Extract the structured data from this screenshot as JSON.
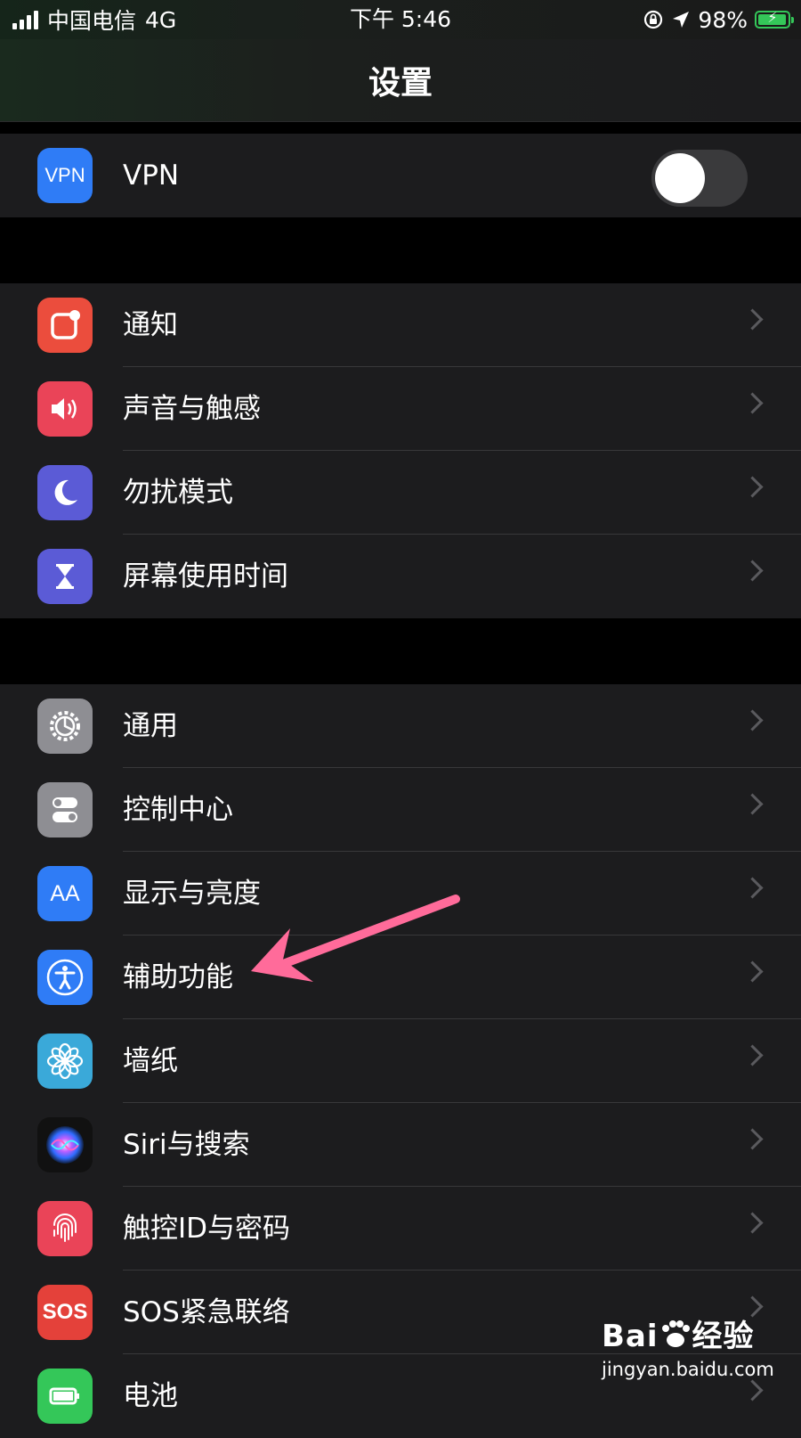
{
  "status_bar": {
    "carrier": "中国电信",
    "network": "4G",
    "time": "下午 5:46",
    "battery_percent": "98%",
    "battery_level": 0.98,
    "icons": [
      "signal-icon",
      "rotation-lock-icon",
      "location-arrow-icon",
      "battery-charging-icon"
    ]
  },
  "nav": {
    "title": "设置"
  },
  "groups": [
    {
      "items": [
        {
          "label": "VPN",
          "icon": "vpn-icon",
          "icon_text": "VPN",
          "color": "#2f7cf6",
          "control": "toggle",
          "toggle_on": false
        }
      ]
    },
    {
      "items": [
        {
          "label": "通知",
          "icon": "notifications-icon",
          "color": "#eb4d3d"
        },
        {
          "label": "声音与触感",
          "icon": "sounds-icon",
          "color": "#ea4458"
        },
        {
          "label": "勿扰模式",
          "icon": "moon-icon",
          "color": "#5b5bd6"
        },
        {
          "label": "屏幕使用时间",
          "icon": "hourglass-icon",
          "color": "#5b5bd6"
        }
      ]
    },
    {
      "items": [
        {
          "label": "通用",
          "icon": "gear-icon",
          "color": "#8e8e93"
        },
        {
          "label": "控制中心",
          "icon": "switches-icon",
          "color": "#8e8e93"
        },
        {
          "label": "显示与亮度",
          "icon": "display-icon",
          "icon_text": "AA",
          "color": "#2f7cf6"
        },
        {
          "label": "辅助功能",
          "icon": "accessibility-icon",
          "color": "#2f7cf6"
        },
        {
          "label": "墙纸",
          "icon": "wallpaper-icon",
          "color": "#3aa9d9"
        },
        {
          "label": "Siri与搜索",
          "icon": "siri-icon",
          "color": "#111111"
        },
        {
          "label": "触控ID与密码",
          "icon": "fingerprint-icon",
          "color": "#ea4458"
        },
        {
          "label": "SOS紧急联络",
          "icon": "sos-icon",
          "icon_text": "SOS",
          "color": "#e4413a"
        },
        {
          "label": "电池",
          "icon": "battery-icon",
          "color": "#34c759"
        }
      ]
    }
  ],
  "annotation": {
    "arrow_color": "#ff6b9a",
    "target": "辅助功能"
  },
  "watermark": {
    "brand": "Bai",
    "brand_suffix": "经验",
    "url": "jingyan.baidu.com"
  }
}
